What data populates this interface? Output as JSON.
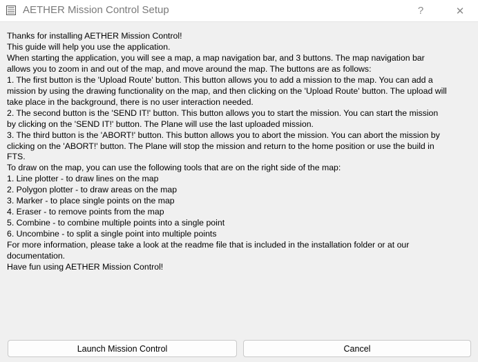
{
  "window": {
    "title": "AETHER Mission Control Setup",
    "help_label": "?",
    "close_label": "✕"
  },
  "content": {
    "lines": [
      "Thanks for installing AETHER Mission Control!",
      "This guide will help you use the application.",
      "When starting the application, you will see a map, a map navigation bar, and 3 buttons. The map navigation bar",
      "allows you to zoom in and out of the map, and move around the map. The buttons are as follows:",
      "1. The first button is the 'Upload Route' button. This button allows you to add a mission to the map. You can add a",
      "mission by using the drawing functionality on the map, and then clicking on the 'Upload Route' button. The upload will",
      "take place in the background, there is no user interaction needed.",
      "2. The second button is the 'SEND IT!' button. This button allows you to start the mission. You can start the mission",
      "by clicking on the 'SEND IT!' button. The Plane will use the last uploaded mission.",
      "3. The third button is the 'ABORT!' button. This button allows you to abort the mission. You can abort the mission by",
      "clicking on the 'ABORT!' button. The Plane will stop the mission and return to the home position or use the build in",
      "FTS.",
      "To draw on the map, you can use the following tools that are on the right side of the map:",
      "1. Line plotter - to draw lines on the map",
      "2. Polygon plotter - to draw areas on the map",
      "3. Marker - to place single points on the map",
      "4. Eraser - to remove points from the map",
      "5. Combine - to combine multiple points into a single point",
      "6. Uncombine - to split a single point into multiple points",
      "For more information, please take a look at the readme file that is included in the installation folder or at our",
      "documentation.",
      "Have fun using AETHER Mission Control!"
    ]
  },
  "buttons": {
    "launch_label": "Launch Mission Control",
    "cancel_label": "Cancel"
  }
}
